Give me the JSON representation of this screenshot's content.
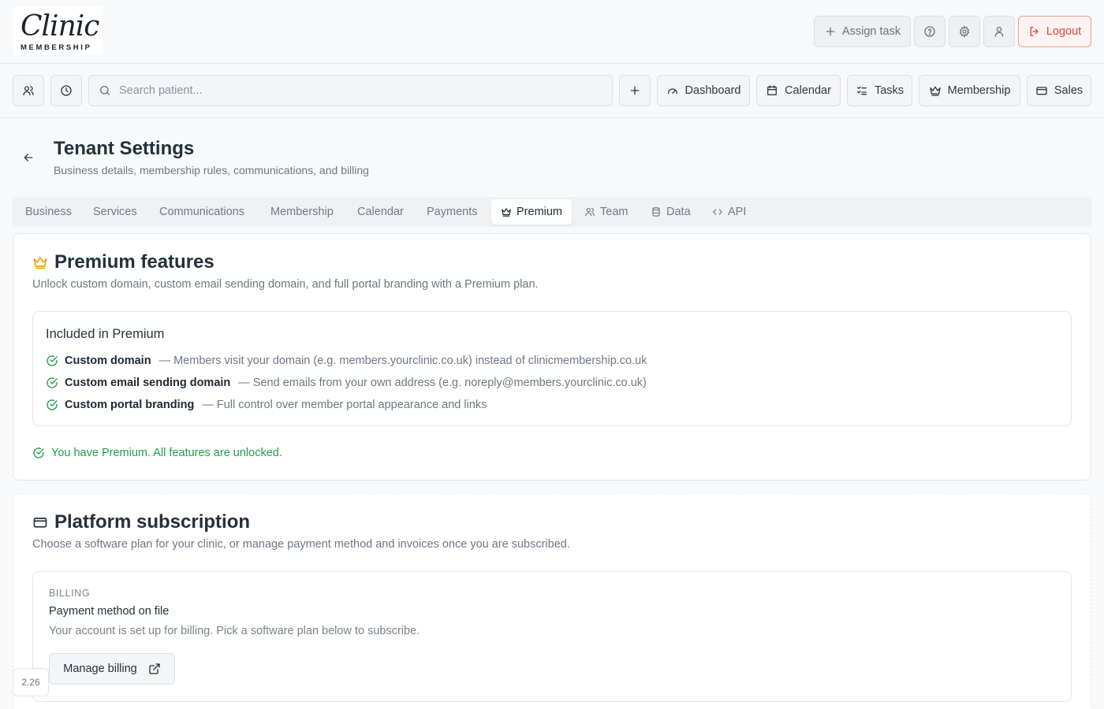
{
  "logo": {
    "script": "Clinic",
    "sub": "MEMBERSHIP"
  },
  "header": {
    "assign_task": "Assign task",
    "logout": "Logout"
  },
  "nav": {
    "search_placeholder": "Search patient...",
    "items": [
      "Dashboard",
      "Calendar",
      "Tasks",
      "Membership",
      "Sales"
    ]
  },
  "page": {
    "title": "Tenant Settings",
    "subtitle": "Business details, membership rules, communications, and billing"
  },
  "tabs": [
    "Business",
    "Services",
    "Communications",
    "Membership",
    "Calendar",
    "Payments",
    "Premium",
    "Team",
    "Data",
    "API"
  ],
  "active_tab": "Premium",
  "premium": {
    "title": "Premium features",
    "subtitle": "Unlock custom domain, custom email sending domain, and full portal branding with a Premium plan.",
    "included_title": "Included in Premium",
    "features": [
      {
        "name": "Custom domain",
        "desc": "— Members visit your domain (e.g. members.yourclinic.co.uk) instead of clinicmembership.co.uk"
      },
      {
        "name": "Custom email sending domain",
        "desc": "— Send emails from your own address (e.g. noreply@members.yourclinic.co.uk)"
      },
      {
        "name": "Custom portal branding",
        "desc": "— Full control over member portal appearance and links"
      }
    ],
    "status": "You have Premium. All features are unlocked."
  },
  "platform": {
    "title": "Platform subscription",
    "subtitle": "Choose a software plan for your clinic, or manage payment method and invoices once you are subscribed.",
    "billing": {
      "label": "BILLING",
      "title": "Payment method on file",
      "text": "Your account is set up for billing. Pick a software plan below to subscribe.",
      "button": "Manage billing"
    }
  },
  "version": "2.26",
  "colors": {
    "premium_crown": "#e9a21a",
    "success": "#1f9d4d",
    "logout": "#d9473b"
  }
}
